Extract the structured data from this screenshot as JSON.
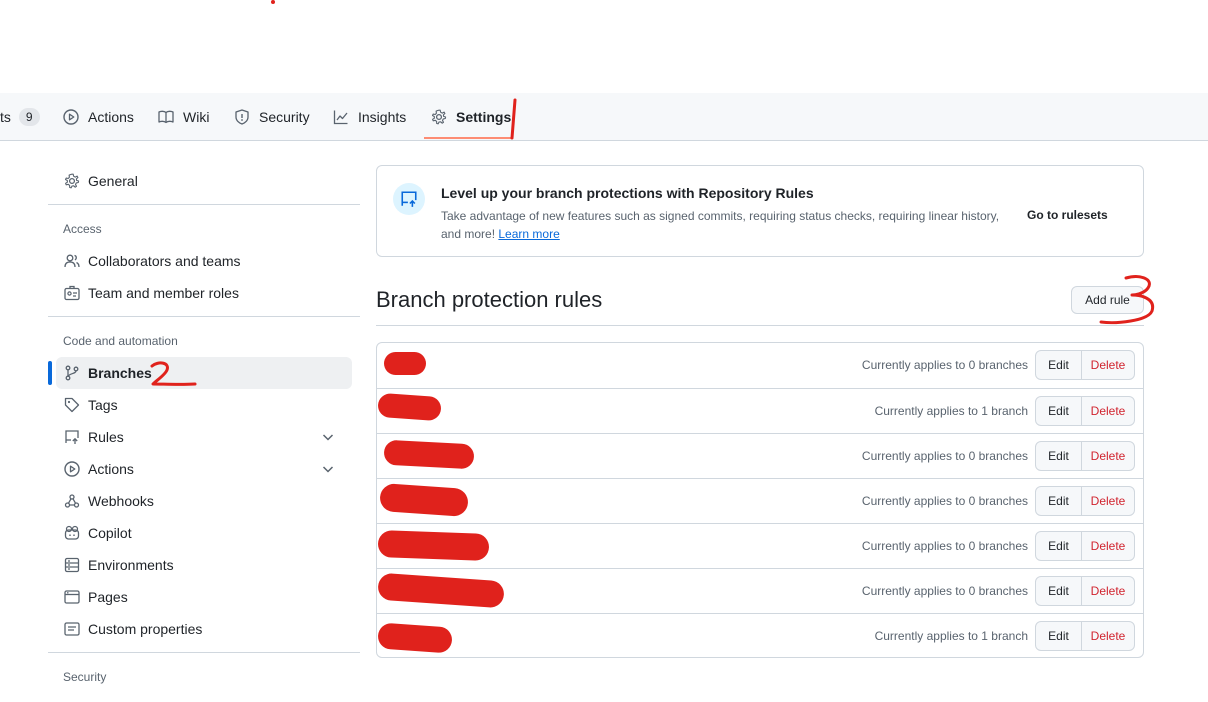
{
  "topnav": {
    "tabs": [
      {
        "label": "ts",
        "count": "9"
      },
      {
        "label": "Actions"
      },
      {
        "label": "Wiki"
      },
      {
        "label": "Security"
      },
      {
        "label": "Insights"
      },
      {
        "label": "Settings",
        "selected": true
      }
    ]
  },
  "sidebar": {
    "general": "General",
    "access_heading": "Access",
    "collaborators": "Collaborators and teams",
    "team_roles": "Team and member roles",
    "code_heading": "Code and automation",
    "branches": "Branches",
    "tags": "Tags",
    "rules": "Rules",
    "actions": "Actions",
    "webhooks": "Webhooks",
    "copilot": "Copilot",
    "environments": "Environments",
    "pages": "Pages",
    "custom_properties": "Custom properties",
    "security_heading": "Security"
  },
  "banner": {
    "title": "Level up your branch protections with Repository Rules",
    "description": "Take advantage of new features such as signed commits, requiring status checks, requiring linear history, and more!",
    "learn_more": "Learn more",
    "cta": "Go to rulesets"
  },
  "main": {
    "heading": "Branch protection rules",
    "add_rule": "Add rule",
    "rules": [
      {
        "status": "Currently applies to 0 branches",
        "edit": "Edit",
        "delete": "Delete"
      },
      {
        "status": "Currently applies to 1 branch",
        "edit": "Edit",
        "delete": "Delete"
      },
      {
        "status": "Currently applies to 0 branches",
        "edit": "Edit",
        "delete": "Delete"
      },
      {
        "status": "Currently applies to 0 branches",
        "edit": "Edit",
        "delete": "Delete"
      },
      {
        "status": "Currently applies to 0 branches",
        "edit": "Edit",
        "delete": "Delete"
      },
      {
        "status": "Currently applies to 0 branches",
        "edit": "Edit",
        "delete": "Delete"
      },
      {
        "status": "Currently applies to 1 branch",
        "edit": "Edit",
        "delete": "Delete"
      }
    ]
  },
  "colors": {
    "accent": "#0969da",
    "danger": "#d1242f",
    "tab_underline": "#fd8c73",
    "annotation": "#e0221c"
  }
}
